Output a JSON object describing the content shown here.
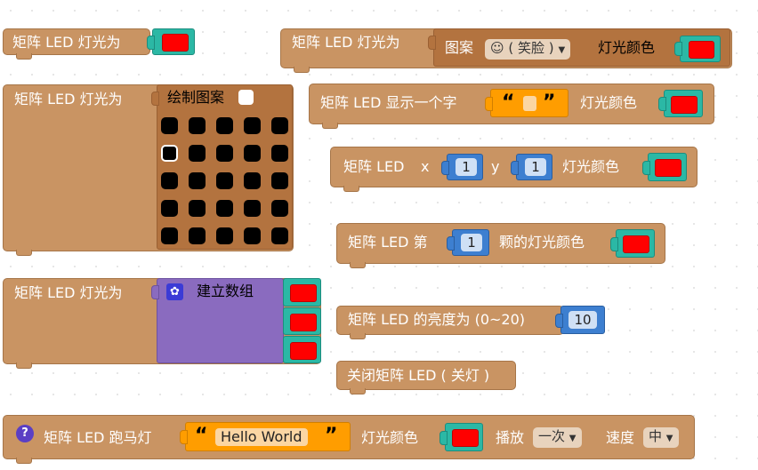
{
  "blocks": {
    "matrix_color": {
      "label": "矩阵 LED 灯光为",
      "color": "#ff0000"
    },
    "pattern": {
      "label": "矩阵 LED 灯光为",
      "kind_label": "图案",
      "selected": "☺ ( 笑脸 )",
      "color_label": "灯光颜色",
      "color": "#ff0000"
    },
    "draw": {
      "label": "矩阵 LED 灯光为",
      "title": "绘制图案",
      "rows": 5,
      "cols": 5,
      "selected_cell": [
        1,
        0
      ]
    },
    "show_char": {
      "label": "矩阵 LED 显示一个字",
      "quote_open": "“",
      "quote_close": "”",
      "color_label": "灯光颜色"
    },
    "xy": {
      "label": "矩阵 LED",
      "x_label": "x",
      "x_value": "1",
      "y_label": "y",
      "y_value": "1",
      "color_label": "灯光颜色"
    },
    "nth": {
      "label": "矩阵 LED 第",
      "value": "1",
      "suffix": "颗的灯光颜色"
    },
    "array": {
      "label": "矩阵 LED 灯光为",
      "build_label": "建立数组",
      "items": 3
    },
    "brightness": {
      "label": "矩阵 LED 的亮度为 (0~20)",
      "value": "10"
    },
    "off": {
      "label": "关闭矩阵 LED ( 关灯 )"
    },
    "marquee": {
      "help": "?",
      "label": "矩阵 LED 跑马灯",
      "quote_open": "“",
      "text": "Hello World",
      "quote_close": "”",
      "color_label": "灯光颜色",
      "play_label": "播放",
      "play_value": "一次",
      "speed_label": "速度",
      "speed_value": "中"
    }
  }
}
